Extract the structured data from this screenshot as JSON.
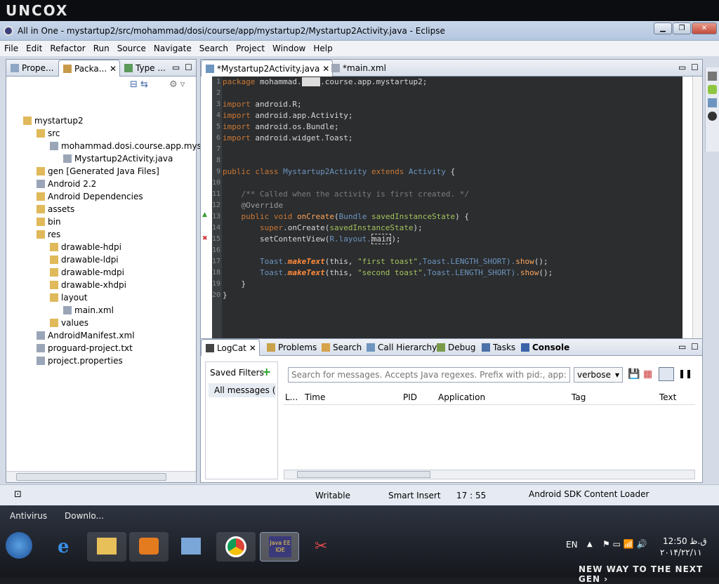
{
  "brand": {
    "logo": "UNCOX",
    "tagline": "NEW WAY TO THE NEXT GEN"
  },
  "window": {
    "title": "All in One - mystartup2/src/mohammad/dosi/course/app/mystartup2/Mystartup2Activity.java - Eclipse"
  },
  "menu": [
    "File",
    "Edit",
    "Refactor",
    "Run",
    "Source",
    "Navigate",
    "Search",
    "Project",
    "Window",
    "Help"
  ],
  "left_tabs": [
    "Prope...",
    "Packa...",
    "Type ..."
  ],
  "tree": [
    {
      "label": "mystartup2",
      "depth": 0
    },
    {
      "label": "src",
      "depth": 1
    },
    {
      "label": "mohammad.dosi.course.app.mysta",
      "depth": 2
    },
    {
      "label": "Mystartup2Activity.java",
      "depth": 3
    },
    {
      "label": "gen [Generated Java Files]",
      "depth": 1
    },
    {
      "label": "Android 2.2",
      "depth": 1
    },
    {
      "label": "Android Dependencies",
      "depth": 1
    },
    {
      "label": "assets",
      "depth": 1
    },
    {
      "label": "bin",
      "depth": 1
    },
    {
      "label": "res",
      "depth": 1
    },
    {
      "label": "drawable-hdpi",
      "depth": 2
    },
    {
      "label": "drawable-ldpi",
      "depth": 2
    },
    {
      "label": "drawable-mdpi",
      "depth": 2
    },
    {
      "label": "drawable-xhdpi",
      "depth": 2
    },
    {
      "label": "layout",
      "depth": 2
    },
    {
      "label": "main.xml",
      "depth": 3
    },
    {
      "label": "values",
      "depth": 2
    },
    {
      "label": "AndroidManifest.xml",
      "depth": 1
    },
    {
      "label": "proguard-project.txt",
      "depth": 1
    },
    {
      "label": "project.properties",
      "depth": 1
    }
  ],
  "editor_tabs": [
    "*Mystartup2Activity.java",
    "*main.xml"
  ],
  "code_lines": [
    "1",
    "2",
    "3",
    "4",
    "5",
    "6",
    "7",
    "8",
    "9",
    "10",
    "11",
    "12",
    "13",
    "14",
    "15",
    "16",
    "17",
    "18",
    "19",
    "20"
  ],
  "code": {
    "l1a": "package",
    "l1b": " mohammad.",
    "l1c": ".course.app.mystartup2;",
    "imp": "import",
    "l3": " android.R;",
    "l4": " android.app.Activity;",
    "l5": " android.os.Bundle;",
    "l6": " android.widget.Toast;",
    "l9a": "public class",
    "l9b": " Mystartup2Activity",
    "l9c": " extends",
    "l9d": " Activity",
    "l9e": " {",
    "l11": "    /** Called when the activity is first created. */",
    "l12": "    @Override",
    "l13a": "    public void",
    "l13b": " onCreate",
    "l13c": "(",
    "l13d": "Bundle",
    "l13e": " savedInstanceState",
    ") {": ") {",
    "l14a": "        super",
    "l14b": ".onCreate(",
    "l14c": "savedInstanceState",
    "l14d": ");",
    "l15a": "        setContentView(",
    "l15b": "R.layout.",
    "l15c": "main",
    "l15d": ");",
    "toast": "        Toast.",
    "make": "makeText",
    "this": "(this, ",
    "s1": "\"first toast\"",
    "s2": "\"second toast\"",
    "lshort": ",Toast.LENGTH_SHORT).",
    "show": "show",
    "end": "();",
    "l19": "    }",
    "l20": "}"
  },
  "bottom_tabs": [
    "LogCat",
    "Problems",
    "Search",
    "Call Hierarchy",
    "Debug",
    "Tasks",
    "Console"
  ],
  "logcat": {
    "saved_filters": "Saved Filters",
    "all_messages": "All messages (no",
    "search_placeholder": "Search for messages. Accepts Java regexes. Prefix with pid:, app:, tag: or text",
    "level": "verbose",
    "columns": [
      "L...",
      "Time",
      "PID",
      "Application",
      "Tag",
      "Text"
    ]
  },
  "status": {
    "writable": "Writable",
    "insert": "Smart Insert",
    "position": "17 : 55",
    "loader": "Android SDK Content Loader"
  },
  "desktop": {
    "icons": [
      "Antivirus",
      "Downlo..."
    ]
  },
  "tray": {
    "lang": "EN",
    "time": "12:50 ق.ظ",
    "date": "۲۰۱۴/۲۲/۱۱"
  },
  "taskbar_apps": [
    "Java EE IDE"
  ],
  "colors": {
    "editor_bg": "#2b2d2f",
    "keyword": "#cc7833",
    "type": "#6e95c0",
    "string": "#a5c25c",
    "comment": "#7c7c7c"
  }
}
